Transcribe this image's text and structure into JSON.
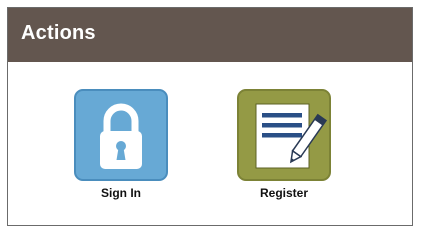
{
  "panel": {
    "title": "Actions",
    "header_color": "#63564f"
  },
  "actions": [
    {
      "label": "Sign In",
      "icon": "lock-icon",
      "tile_color": "#67a9d5"
    },
    {
      "label": "Register",
      "icon": "document-pen-icon",
      "tile_color": "#949a45"
    }
  ]
}
